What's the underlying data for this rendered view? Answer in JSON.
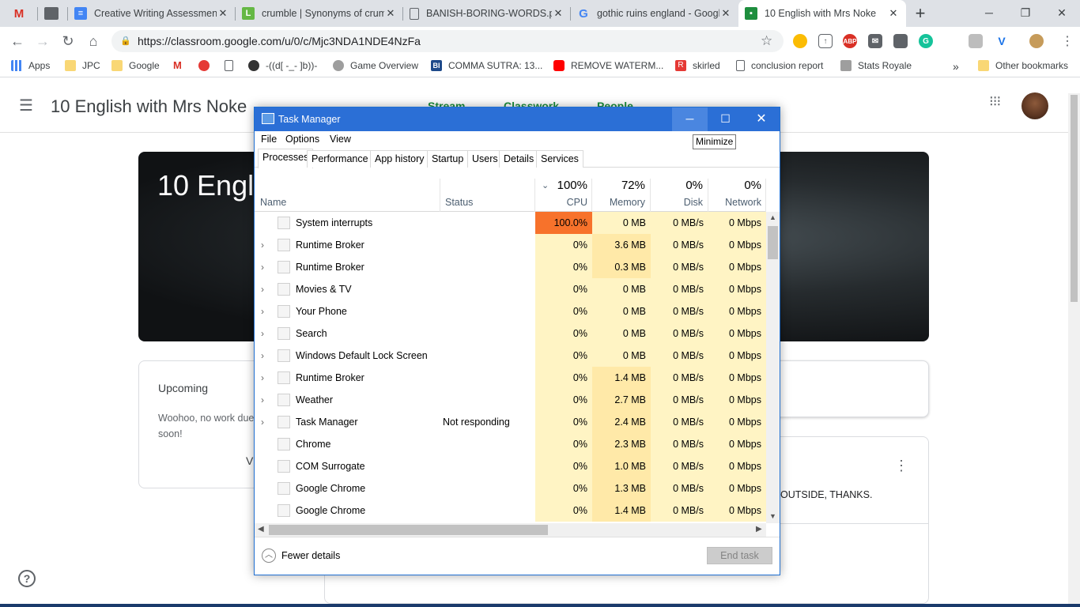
{
  "browser": {
    "tabs": [
      {
        "title": "",
        "favicon": "gmail-icon"
      },
      {
        "title": "",
        "favicon": "extension-icon"
      },
      {
        "title": "Creative Writing Assessment",
        "favicon": "docs-icon"
      },
      {
        "title": "crumble | Synonyms of crumble",
        "favicon": "lexico-icon"
      },
      {
        "title": "BANISH-BORING-WORDS.pdf",
        "favicon": "file-icon"
      },
      {
        "title": "gothic ruins england - Google Search",
        "favicon": "google-icon"
      },
      {
        "title": "10 English with Mrs Noke",
        "favicon": "classroom-icon"
      }
    ],
    "url": "https://classroom.google.com/u/0/c/Mjc3NDA1NDE4NzFa",
    "bookmarks": [
      {
        "label": "Apps"
      },
      {
        "label": "JPC"
      },
      {
        "label": "Google"
      },
      {
        "label": ""
      },
      {
        "label": ""
      },
      {
        "label": ""
      },
      {
        "label": "-((d[ -_- ]b))-"
      },
      {
        "label": "Game Overview"
      },
      {
        "label": "COMMA SUTRA: 13..."
      },
      {
        "label": "REMOVE WATERM..."
      },
      {
        "label": "skirled"
      },
      {
        "label": "conclusion report"
      },
      {
        "label": "Stats Royale"
      }
    ],
    "more_bookmarks": "»",
    "other_bookmarks": "Other bookmarks",
    "colors": {
      "accent_blue": "#2b6fd6",
      "cpu_hot": "#f7722b",
      "cpu_warm": "#fff4c4",
      "memory_warm": "#ffe9a8"
    }
  },
  "classroom": {
    "class_title": "10 English with Mrs Noke",
    "nav_tabs": [
      "Stream",
      "Classwork",
      "People"
    ],
    "banner_title": "10 Engli",
    "upcoming_title": "Upcoming",
    "upcoming_text": "Woohoo, no work due soon!",
    "upcoming_link": "V",
    "post_text": "OUTSIDE, THANKS.",
    "help": "?"
  },
  "task_manager": {
    "title": "Task Manager",
    "menu": [
      "File",
      "Options",
      "View"
    ],
    "tabs": [
      "Processes",
      "Performance",
      "App history",
      "Startup",
      "Users",
      "Details",
      "Services"
    ],
    "columns": {
      "name": "Name",
      "status": "Status",
      "cpu": {
        "label": "CPU",
        "pct": "100%"
      },
      "memory": {
        "label": "Memory",
        "pct": "72%"
      },
      "disk": {
        "label": "Disk",
        "pct": "0%"
      },
      "network": {
        "label": "Network",
        "pct": "0%"
      }
    },
    "rows": [
      {
        "name": "System interrupts",
        "expandable": false,
        "status": "",
        "cpu": "100.0%",
        "memory": "0 MB",
        "disk": "0 MB/s",
        "network": "0 Mbps"
      },
      {
        "name": "Runtime Broker",
        "expandable": true,
        "status": "",
        "cpu": "0%",
        "memory": "3.6 MB",
        "disk": "0 MB/s",
        "network": "0 Mbps"
      },
      {
        "name": "Runtime Broker",
        "expandable": true,
        "status": "",
        "cpu": "0%",
        "memory": "0.3 MB",
        "disk": "0 MB/s",
        "network": "0 Mbps"
      },
      {
        "name": "Movies & TV",
        "expandable": true,
        "status": "",
        "cpu": "0%",
        "memory": "0 MB",
        "disk": "0 MB/s",
        "network": "0 Mbps"
      },
      {
        "name": "Your Phone",
        "expandable": true,
        "status": "",
        "cpu": "0%",
        "memory": "0 MB",
        "disk": "0 MB/s",
        "network": "0 Mbps"
      },
      {
        "name": "Search",
        "expandable": true,
        "status": "",
        "cpu": "0%",
        "memory": "0 MB",
        "disk": "0 MB/s",
        "network": "0 Mbps"
      },
      {
        "name": "Windows Default Lock Screen",
        "expandable": true,
        "status": "",
        "cpu": "0%",
        "memory": "0 MB",
        "disk": "0 MB/s",
        "network": "0 Mbps"
      },
      {
        "name": "Runtime Broker",
        "expandable": true,
        "status": "",
        "cpu": "0%",
        "memory": "1.4 MB",
        "disk": "0 MB/s",
        "network": "0 Mbps"
      },
      {
        "name": "Weather",
        "expandable": true,
        "status": "",
        "cpu": "0%",
        "memory": "2.7 MB",
        "disk": "0 MB/s",
        "network": "0 Mbps"
      },
      {
        "name": "Task Manager",
        "expandable": true,
        "status": "Not responding",
        "cpu": "0%",
        "memory": "2.4 MB",
        "disk": "0 MB/s",
        "network": "0 Mbps"
      },
      {
        "name": "Chrome",
        "expandable": false,
        "status": "",
        "cpu": "0%",
        "memory": "2.3 MB",
        "disk": "0 MB/s",
        "network": "0 Mbps"
      },
      {
        "name": "COM Surrogate",
        "expandable": false,
        "status": "",
        "cpu": "0%",
        "memory": "1.0 MB",
        "disk": "0 MB/s",
        "network": "0 Mbps"
      },
      {
        "name": "Google Chrome",
        "expandable": false,
        "status": "",
        "cpu": "0%",
        "memory": "1.3 MB",
        "disk": "0 MB/s",
        "network": "0 Mbps"
      },
      {
        "name": "Google Chrome",
        "expandable": false,
        "status": "",
        "cpu": "0%",
        "memory": "1.4 MB",
        "disk": "0 MB/s",
        "network": "0 Mbps"
      }
    ],
    "fewer_details": "Fewer details",
    "end_task": "End task",
    "tooltip": "Minimize"
  }
}
